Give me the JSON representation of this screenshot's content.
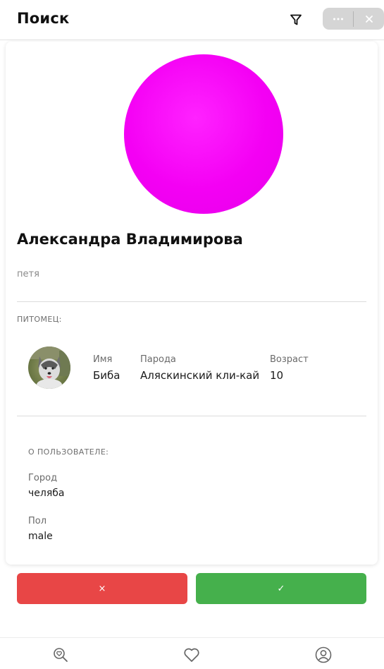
{
  "header": {
    "title": "Поиск",
    "filter_icon": "funnel-icon",
    "more_icon": "more-dots-icon",
    "close_icon": "close-icon"
  },
  "profile": {
    "name": "Александра Владимирова",
    "bio": "петя",
    "avatar_color": "#f400f4"
  },
  "pet_section": {
    "title": "ПИТОМЕЦ:",
    "columns": [
      {
        "label": "Имя",
        "value": "Биба"
      },
      {
        "label": "Парода",
        "value": "Аляскинский кли-кай"
      },
      {
        "label": "Возраст",
        "value": "10"
      }
    ]
  },
  "about_section": {
    "title": "О ПОЛЬЗОВАТЕЛЕ:",
    "fields": [
      {
        "label": "Город",
        "value": "челяба"
      },
      {
        "label": "Пол",
        "value": "male"
      }
    ]
  },
  "actions": {
    "reject_label": "×",
    "accept_label": "✓",
    "reject_color": "#e84646",
    "accept_color": "#45b04c"
  },
  "bottom_nav": {
    "items": [
      {
        "icon": "search-heart-icon"
      },
      {
        "icon": "heart-icon"
      },
      {
        "icon": "profile-icon"
      }
    ]
  }
}
